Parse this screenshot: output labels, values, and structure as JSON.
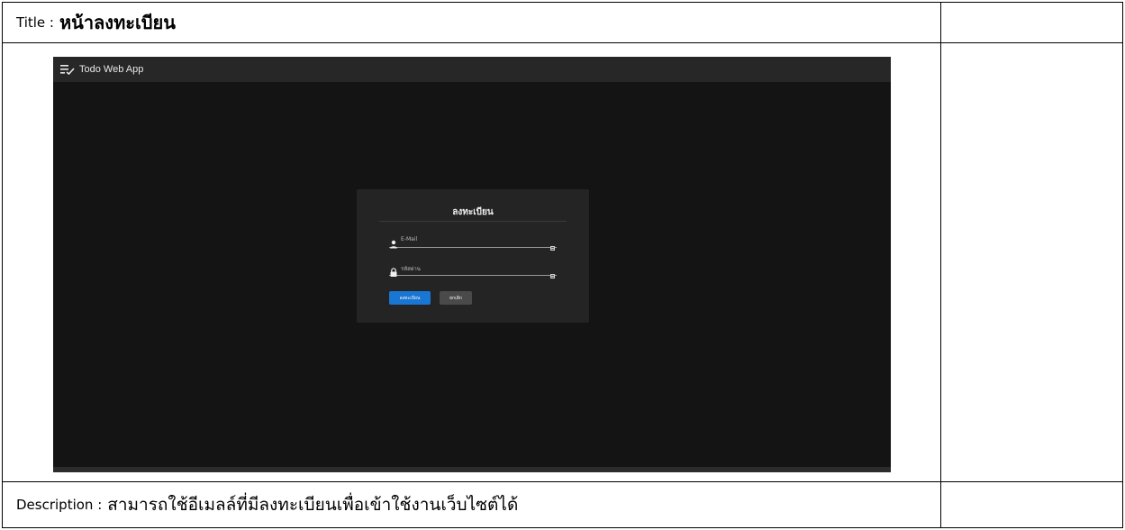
{
  "title_row": {
    "label": "Title :",
    "value": "หน้าลงทะเบียน"
  },
  "screenshot": {
    "app_title": "Todo Web App",
    "app_icon": "playlist-check-icon",
    "form": {
      "title": "ลงทะเบียน",
      "email_placeholder": "E-Mail",
      "password_placeholder": "รหัสผ่าน",
      "register_button": "ลงทะเบียน",
      "cancel_button": "ยกเลิก"
    },
    "colors": {
      "background": "#141414",
      "appbar": "#272727",
      "card": "#242424",
      "primary": "#1976d2",
      "secondary": "#4a4a4a"
    }
  },
  "description_row": {
    "label": "Description :",
    "value": "สามารถใช้อีเมลล์ที่มีลงทะเบียนเพื่อเข้าใช้งานเว็บไซต์ได้"
  }
}
